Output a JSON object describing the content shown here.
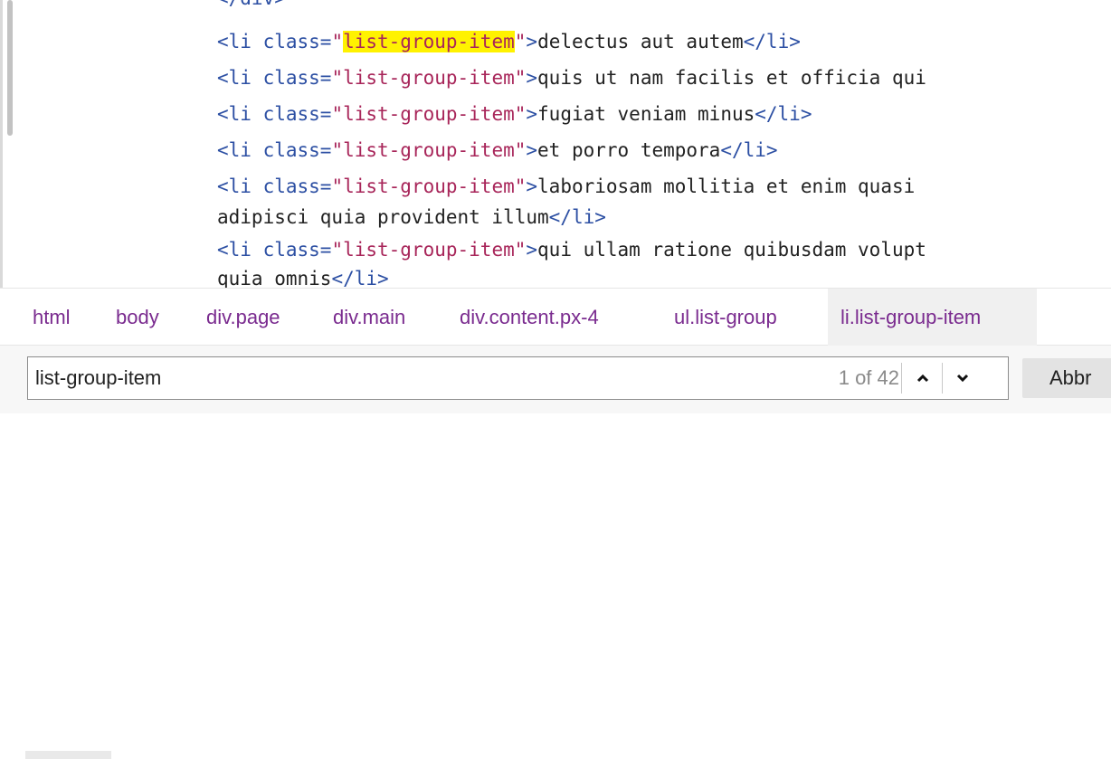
{
  "source": {
    "lines": [
      {
        "segments": [
          {
            "cls": "tag",
            "t": "</div>"
          }
        ]
      },
      {
        "segments": [
          {
            "cls": "tag",
            "t": "<li "
          },
          {
            "cls": "attr",
            "t": "class="
          },
          {
            "cls": "val",
            "t": "\""
          },
          {
            "cls": "val hl",
            "t": "list-group-item"
          },
          {
            "cls": "val",
            "t": "\""
          },
          {
            "cls": "tag",
            "t": ">"
          },
          {
            "cls": "txt",
            "t": "delectus aut autem"
          },
          {
            "cls": "tag",
            "t": "</li>"
          }
        ]
      },
      {
        "segments": [
          {
            "cls": "tag",
            "t": "<li "
          },
          {
            "cls": "attr",
            "t": "class="
          },
          {
            "cls": "val",
            "t": "\"list-group-item\""
          },
          {
            "cls": "tag",
            "t": ">"
          },
          {
            "cls": "txt",
            "t": "quis ut nam facilis et officia qui"
          }
        ]
      },
      {
        "segments": [
          {
            "cls": "tag",
            "t": "<li "
          },
          {
            "cls": "attr",
            "t": "class="
          },
          {
            "cls": "val",
            "t": "\"list-group-item\""
          },
          {
            "cls": "tag",
            "t": ">"
          },
          {
            "cls": "txt",
            "t": "fugiat veniam minus"
          },
          {
            "cls": "tag",
            "t": "</li>"
          }
        ]
      },
      {
        "segments": [
          {
            "cls": "tag",
            "t": "<li "
          },
          {
            "cls": "attr",
            "t": "class="
          },
          {
            "cls": "val",
            "t": "\"list-group-item\""
          },
          {
            "cls": "tag",
            "t": ">"
          },
          {
            "cls": "txt",
            "t": "et porro tempora"
          },
          {
            "cls": "tag",
            "t": "</li>"
          }
        ]
      },
      {
        "segments": [
          {
            "cls": "tag",
            "t": "<li "
          },
          {
            "cls": "attr",
            "t": "class="
          },
          {
            "cls": "val",
            "t": "\"list-group-item\""
          },
          {
            "cls": "tag",
            "t": ">"
          },
          {
            "cls": "txt",
            "t": "laboriosam mollitia et enim quasi"
          }
        ]
      },
      {
        "segments": [
          {
            "cls": "txt",
            "t": "adipisci quia provident illum"
          },
          {
            "cls": "tag",
            "t": "</li>"
          }
        ]
      },
      {
        "segments": [
          {
            "cls": "tag",
            "t": "<li "
          },
          {
            "cls": "attr",
            "t": "class="
          },
          {
            "cls": "val",
            "t": "\"list-group-item\""
          },
          {
            "cls": "tag",
            "t": ">"
          },
          {
            "cls": "txt",
            "t": "qui ullam ratione quibusdam volupt"
          }
        ]
      },
      {
        "segments": [
          {
            "cls": "txt",
            "t": "quia omnis"
          },
          {
            "cls": "tag",
            "t": "</li>"
          }
        ]
      }
    ]
  },
  "breadcrumb": {
    "items": [
      "html",
      "body",
      "div.page",
      "div.main",
      "div.content.px-4",
      "ul.list-group",
      "li.list-group-item"
    ],
    "active_index": 6
  },
  "find": {
    "query": "list-group-item",
    "count": "1 of 42",
    "prev_icon": "chevron-up-icon",
    "next_icon": "chevron-down-icon",
    "cancel_label": "Abbr"
  },
  "colors": {
    "tag": "#2c4fa3",
    "value": "#a8265a",
    "highlight": "#fff200",
    "breadcrumb": "#7a2b8f"
  }
}
